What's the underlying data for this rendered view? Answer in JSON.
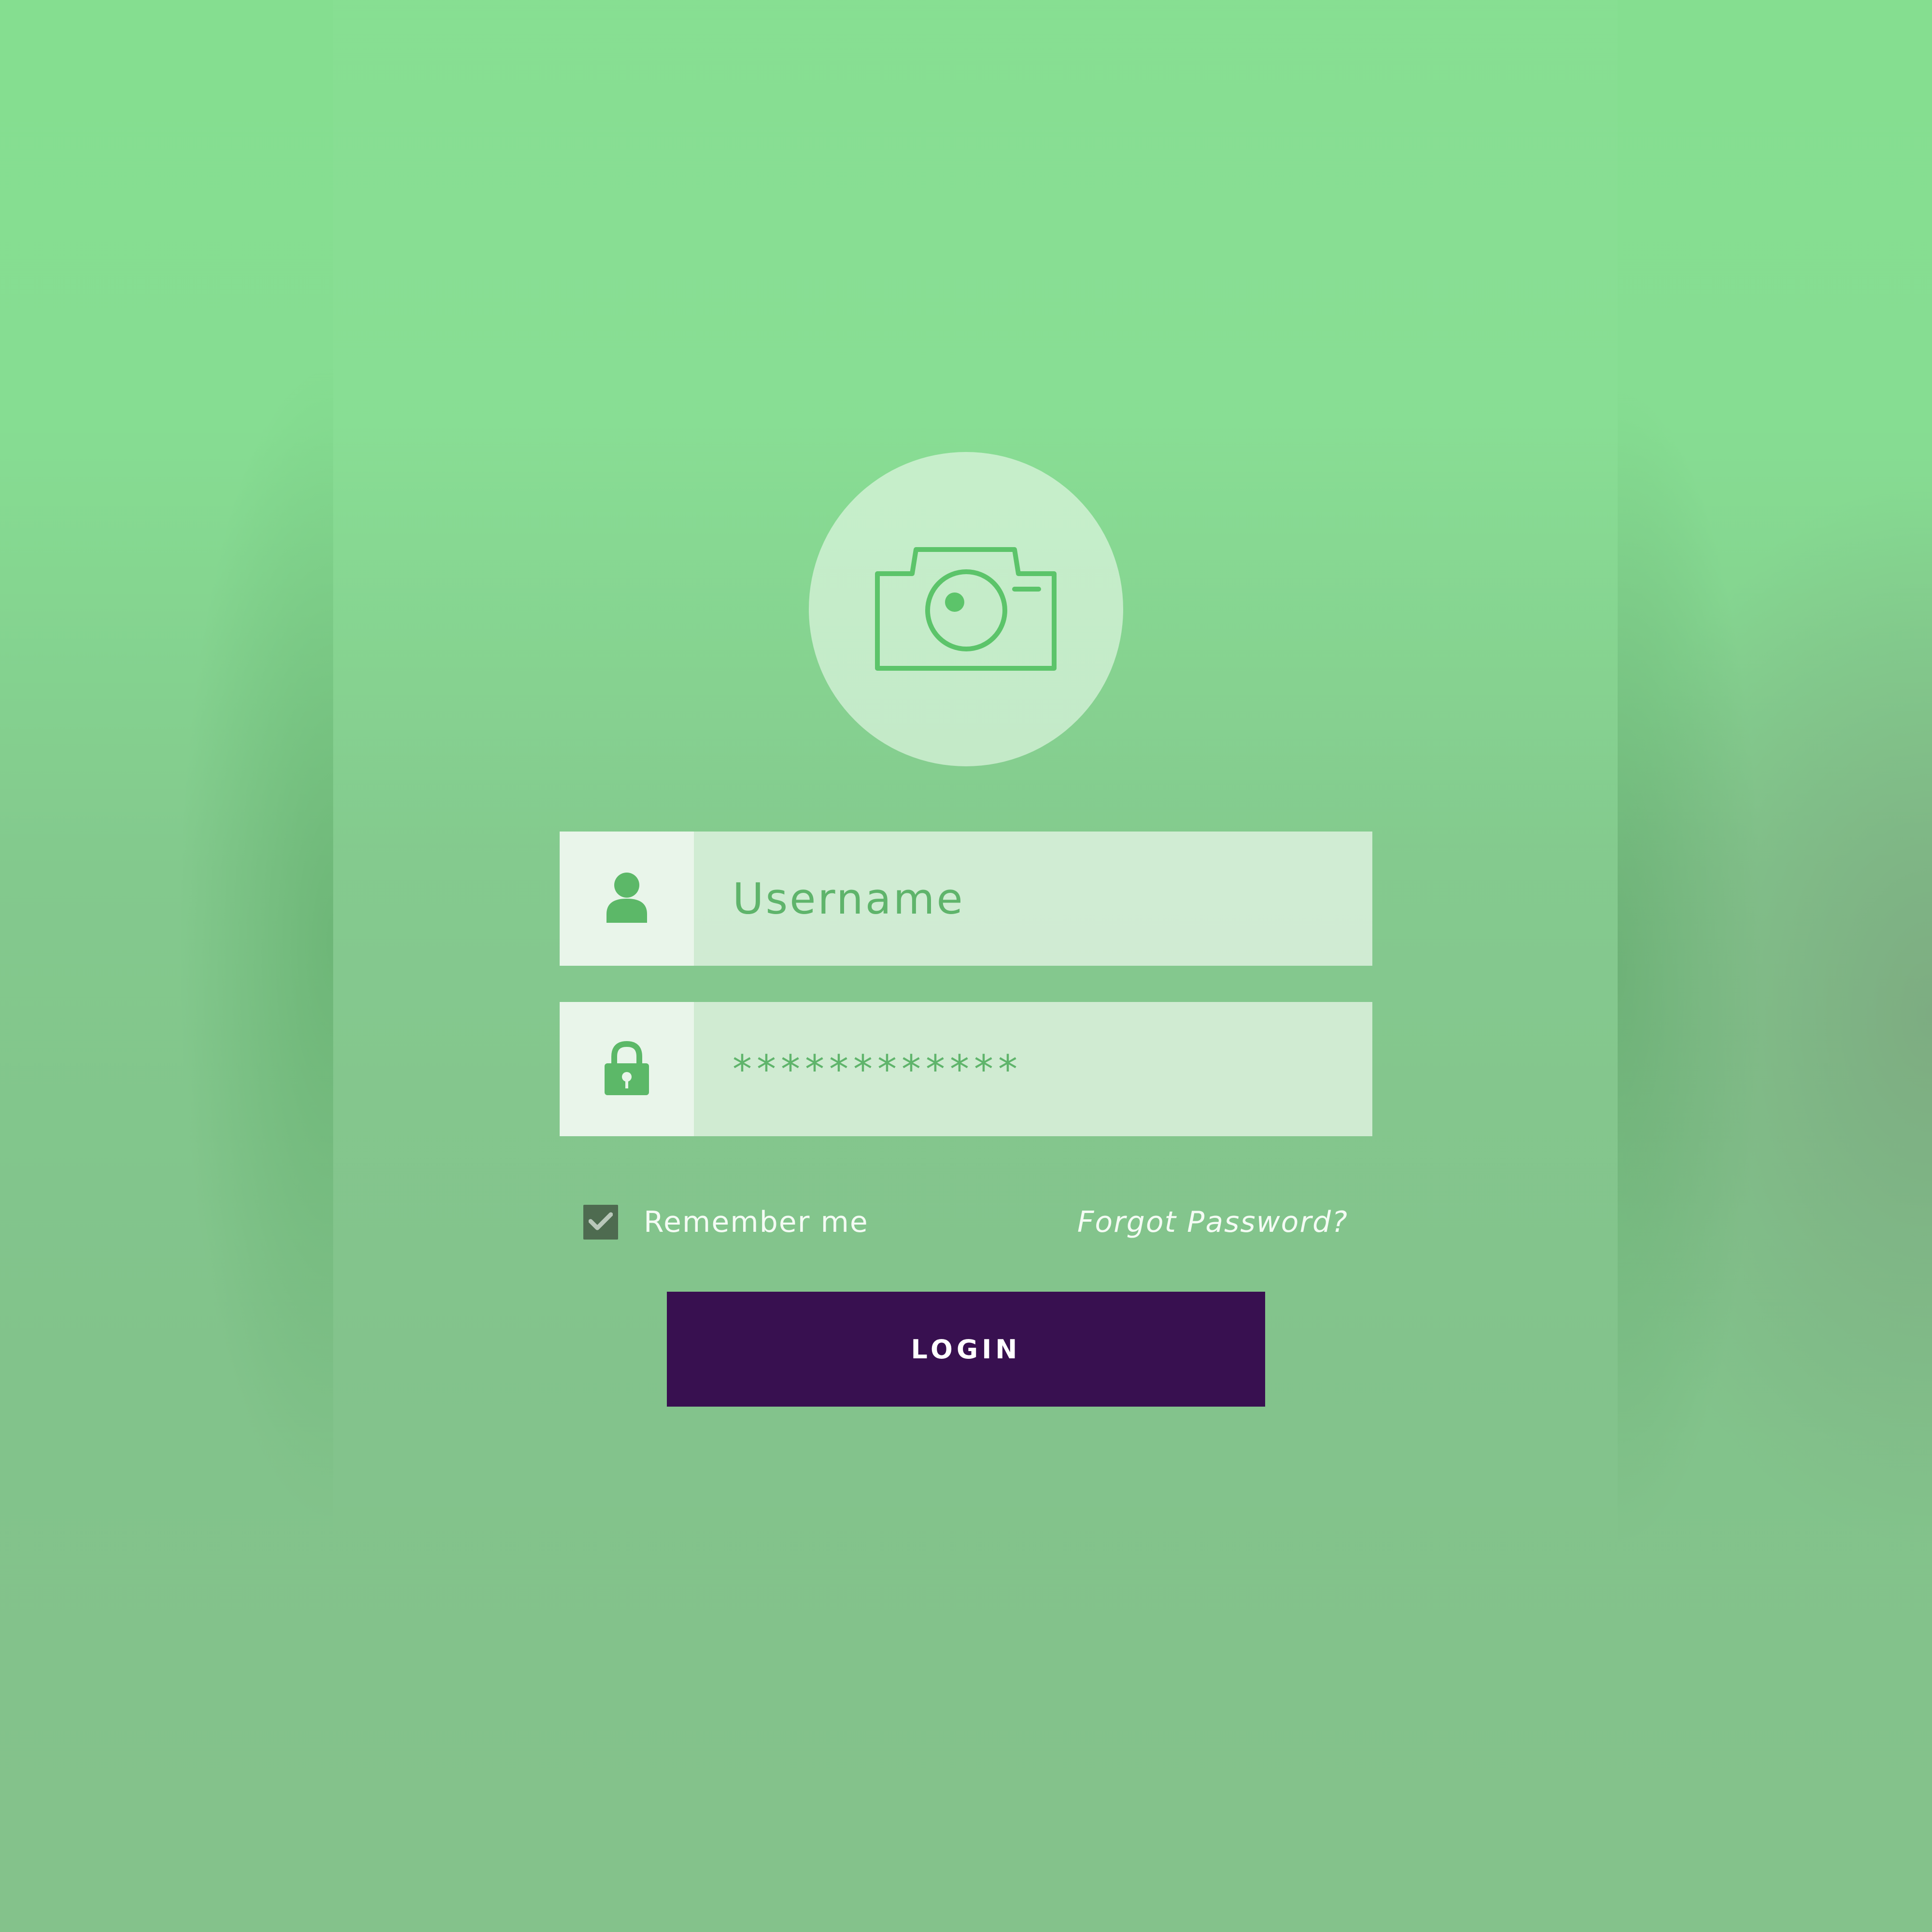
{
  "icons": {
    "avatar": "camera-icon",
    "username": "user-icon",
    "password": "lock-icon",
    "checkbox": "checkmark-icon"
  },
  "form": {
    "username_placeholder": "Username",
    "password_value": "************",
    "remember_label": "Remember me",
    "remember_checked": true,
    "forgot_label": "Forgot Password?",
    "login_label": "LOGIN"
  },
  "colors": {
    "background": "#86d891",
    "icon_green": "#5cb868",
    "button": "#381050",
    "checkbox": "#4e6b50"
  }
}
